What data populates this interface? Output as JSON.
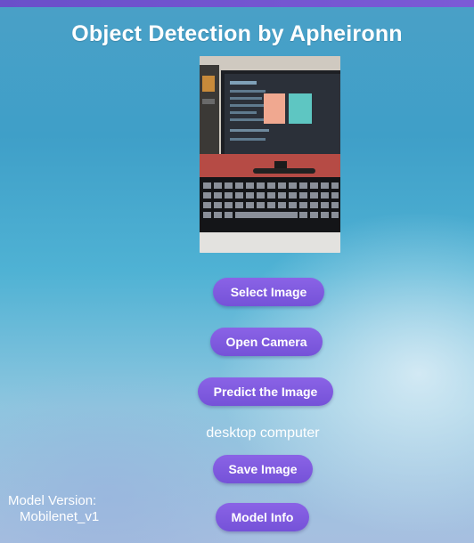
{
  "app": {
    "title": "Object Detection by Apheironn"
  },
  "buttons": {
    "select_image": "Select Image",
    "open_camera": "Open Camera",
    "predict": "Predict the Image",
    "save_image": "Save Image",
    "model_info": "Model Info"
  },
  "prediction": {
    "result": "desktop computer"
  },
  "model": {
    "label": "Model Version:",
    "value": "Mobilenet_v1"
  },
  "colors": {
    "accent": "#7a56dc",
    "top_bar": "#6a4fc9"
  }
}
